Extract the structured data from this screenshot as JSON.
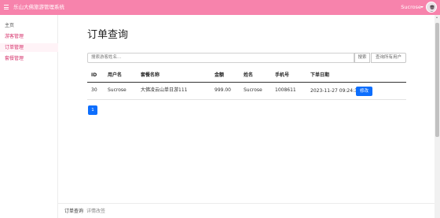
{
  "header": {
    "title": "乐山大佛旅游管理系统",
    "user_name": "Sucrose"
  },
  "sidebar": {
    "items": [
      {
        "label": "主页"
      },
      {
        "label": "游客管理"
      },
      {
        "label": "订单管理"
      },
      {
        "label": "套餐管理"
      }
    ]
  },
  "main": {
    "title": "订单查询",
    "search": {
      "placeholder": "搜索游客姓名...",
      "search_label": "搜索",
      "all_label": "查询所有用户"
    },
    "table": {
      "columns": [
        "ID",
        "用户名",
        "套餐名称",
        "金额",
        "姓名",
        "手机号",
        "下单日期"
      ],
      "rows": [
        {
          "id": "30",
          "username": "Sucrose",
          "package": "大佛凌云山单日游111",
          "amount": "999.00",
          "name": "Sucrose",
          "phone": "1008611",
          "date": "2023-11-27 09:24:34",
          "action": "修改"
        }
      ]
    },
    "pagination": {
      "current": "1"
    }
  },
  "footer": {
    "items": [
      "订单查询",
      "详情改签"
    ]
  },
  "colors": {
    "brand": "#f783ac",
    "primary": "#0d6efd"
  }
}
